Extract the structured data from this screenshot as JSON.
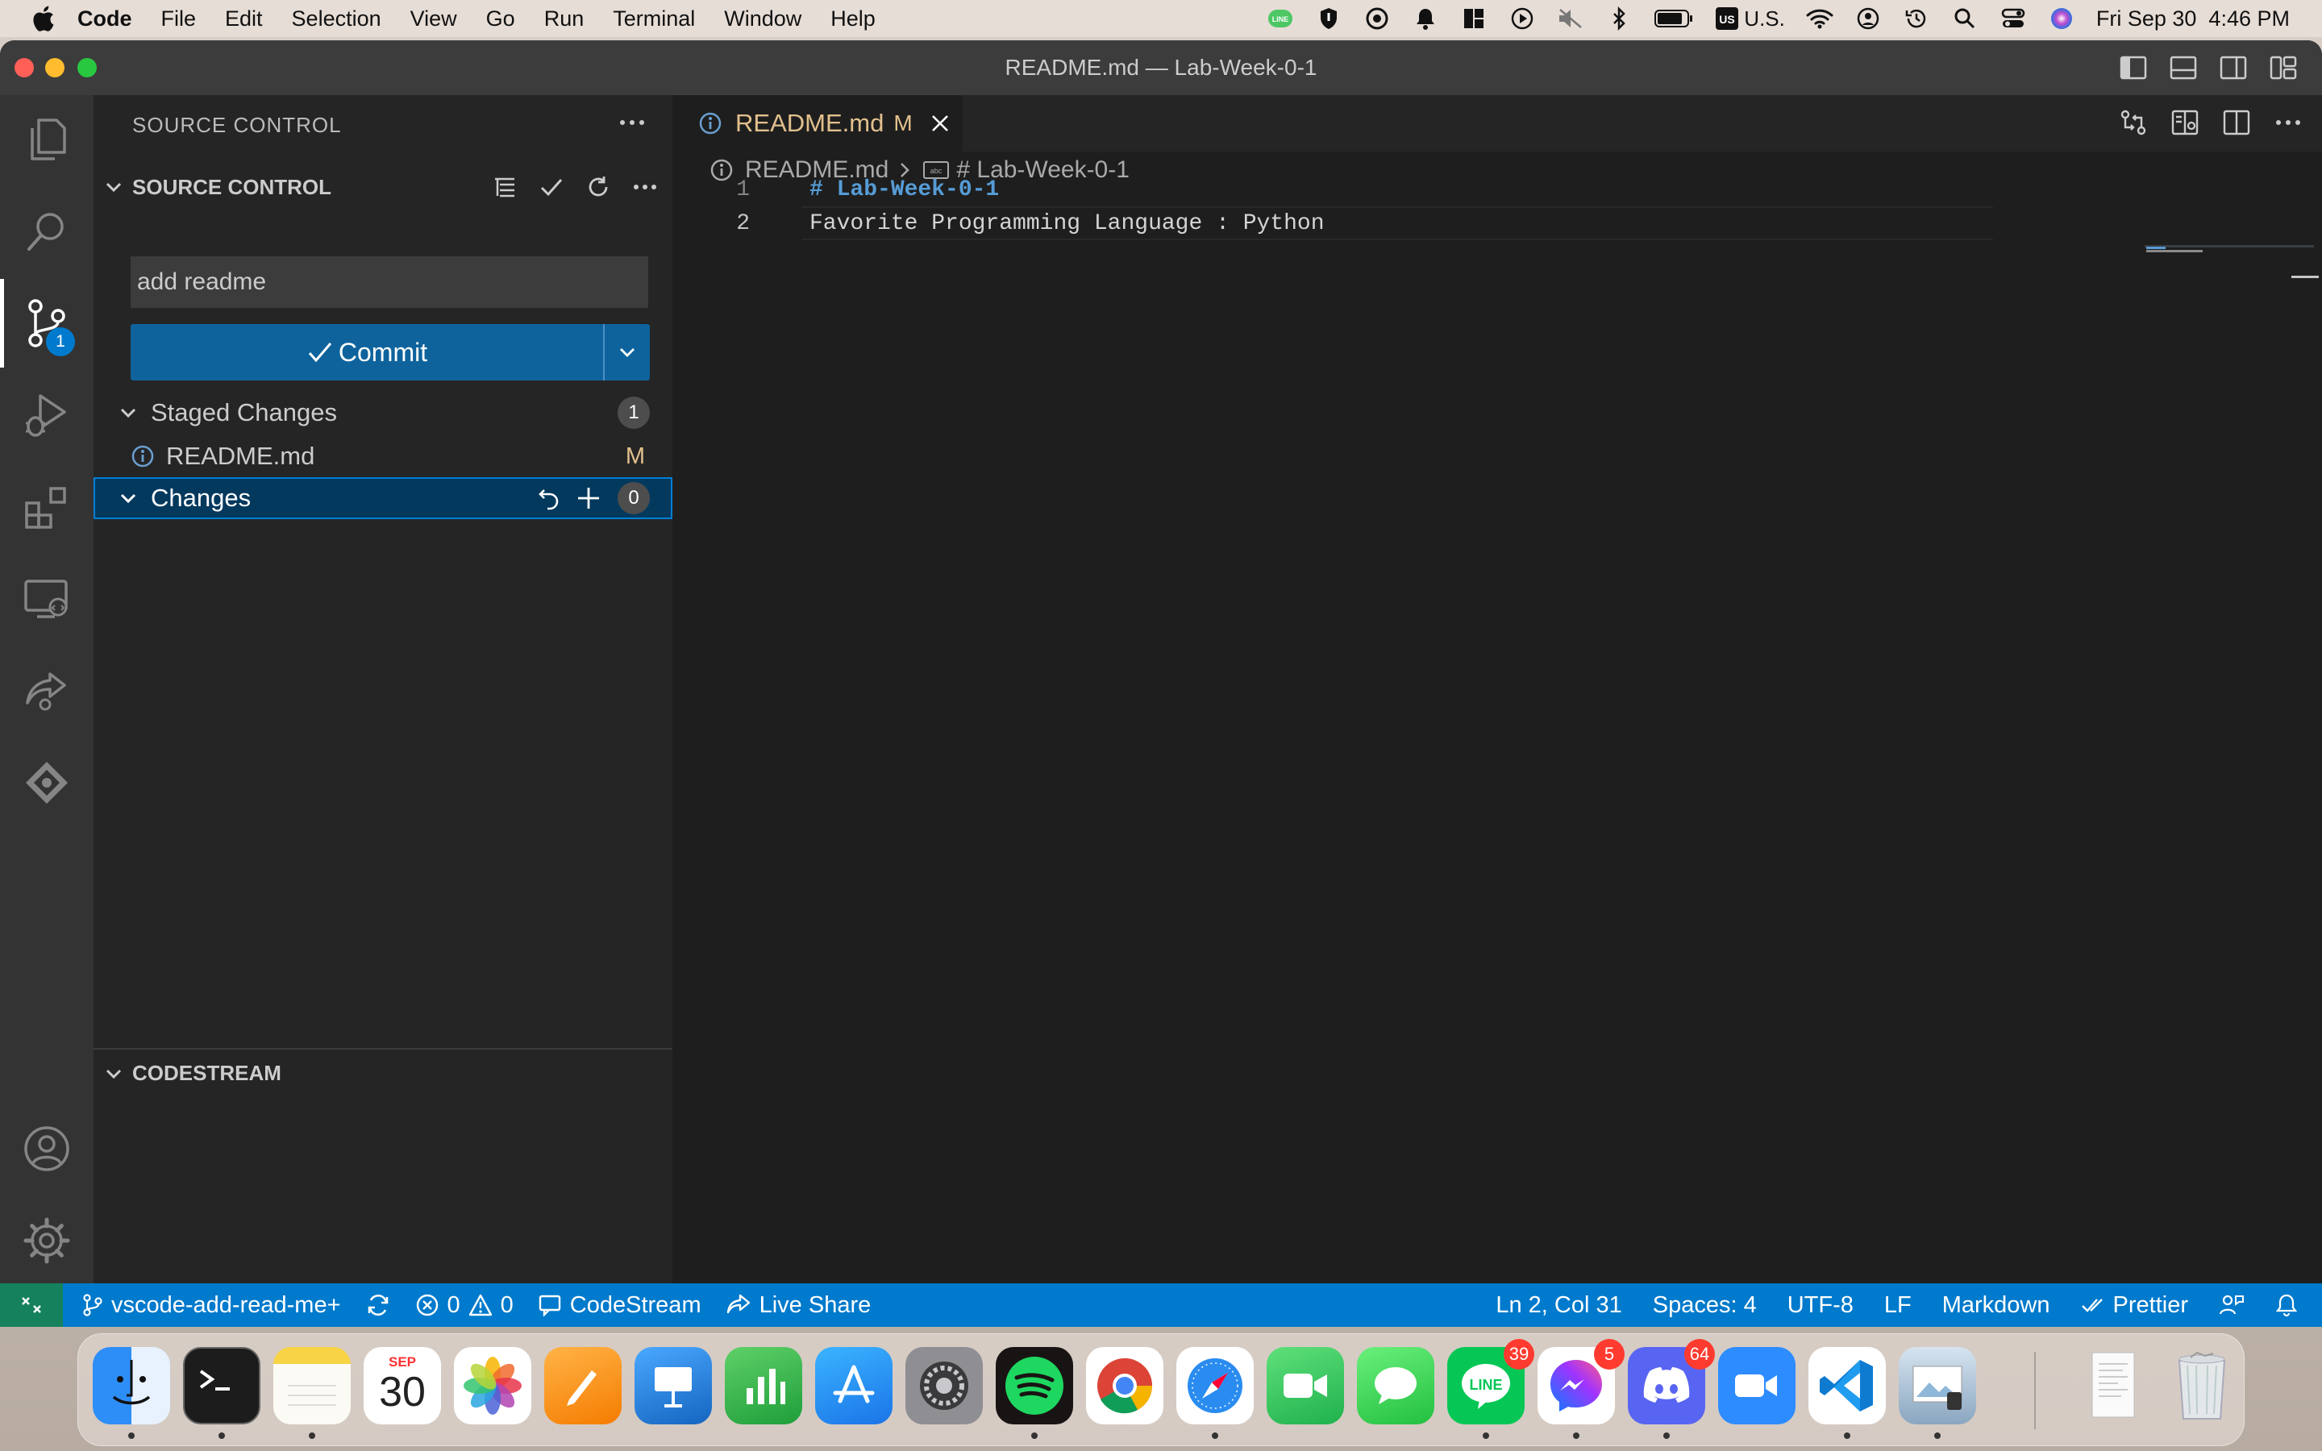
{
  "menubar": {
    "app_name": "Code",
    "items": [
      "File",
      "Edit",
      "Selection",
      "View",
      "Go",
      "Run",
      "Terminal",
      "Window",
      "Help"
    ],
    "input_source": "U.S.",
    "clock": "Fri Sep 30  4:46 PM",
    "status_icons": [
      "line-icon",
      "vpn-shield-icon",
      "sync-app-icon",
      "notification-bell-icon",
      "layout-app-icon",
      "play-icon",
      "mute-icon",
      "bluetooth-icon",
      "battery-icon",
      "keyboard-flag-icon",
      "wifi-icon",
      "user-icon",
      "time-machine-icon",
      "spotlight-icon",
      "control-center-icon",
      "siri-icon"
    ]
  },
  "window": {
    "title": "README.md — Lab-Week-0-1"
  },
  "activity_bar": {
    "items": [
      "explorer",
      "search",
      "source-control",
      "run-and-debug",
      "extensions",
      "remote-explorer",
      "live-share",
      "codestream"
    ],
    "active": "source-control",
    "source_control_badge": "1",
    "bottom_items": [
      "accounts",
      "manage"
    ]
  },
  "sidebar": {
    "header": "SOURCE CONTROL",
    "section_title": "SOURCE CONTROL",
    "commit_message": "add readme",
    "commit_label": "Commit",
    "staged": {
      "label": "Staged Changes",
      "count": "1",
      "files": [
        {
          "name": "README.md",
          "status": "M"
        }
      ]
    },
    "changes": {
      "label": "Changes",
      "count": "0"
    },
    "codestream_title": "CODESTREAM"
  },
  "editor": {
    "tab": {
      "name": "README.md",
      "status": "M"
    },
    "breadcrumb": {
      "file": "README.md",
      "symbol": "# Lab-Week-0-1"
    },
    "lines": [
      {
        "number": "1",
        "text": "# Lab-Week-0-1"
      },
      {
        "number": "2",
        "text": "Favorite Programming Language : Python"
      }
    ]
  },
  "statusbar": {
    "branch": "vscode-add-read-me+",
    "errors": "0",
    "warnings": "0",
    "codestream": "CodeStream",
    "live_share": "Live Share",
    "position": "Ln 2, Col 31",
    "indent": "Spaces: 4",
    "encoding": "UTF-8",
    "eol": "LF",
    "language": "Markdown",
    "formatter": "Prettier"
  },
  "dock": {
    "apps": [
      "Finder",
      "Terminal",
      "Notes",
      "Calendar",
      "Photos",
      "Pages",
      "Keynote",
      "Numbers",
      "App Store",
      "System Preferences",
      "Spotify",
      "Google Chrome",
      "Safari",
      "FaceTime",
      "Messages",
      "LINE",
      "Messenger",
      "Discord",
      "Zoom",
      "Visual Studio Code",
      "Preview"
    ],
    "calendar_month": "SEP",
    "calendar_day": "30",
    "badges": {
      "line": "39",
      "messenger": "5",
      "discord": "64"
    }
  },
  "colors": {
    "accent": "#007acc",
    "commit_button": "#0e639c",
    "modified": "#e2c08d",
    "heading": "#569cd6"
  }
}
